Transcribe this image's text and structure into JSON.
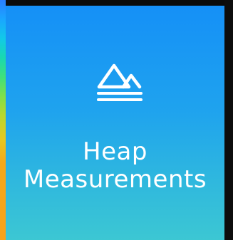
{
  "tile": {
    "label_line1": "Heap",
    "label_line2": "Measurements",
    "icon": "heap-mountains-icon",
    "background_top": "#1590f7",
    "background_bottom": "#3cc7d3",
    "text_color": "#ffffff"
  }
}
